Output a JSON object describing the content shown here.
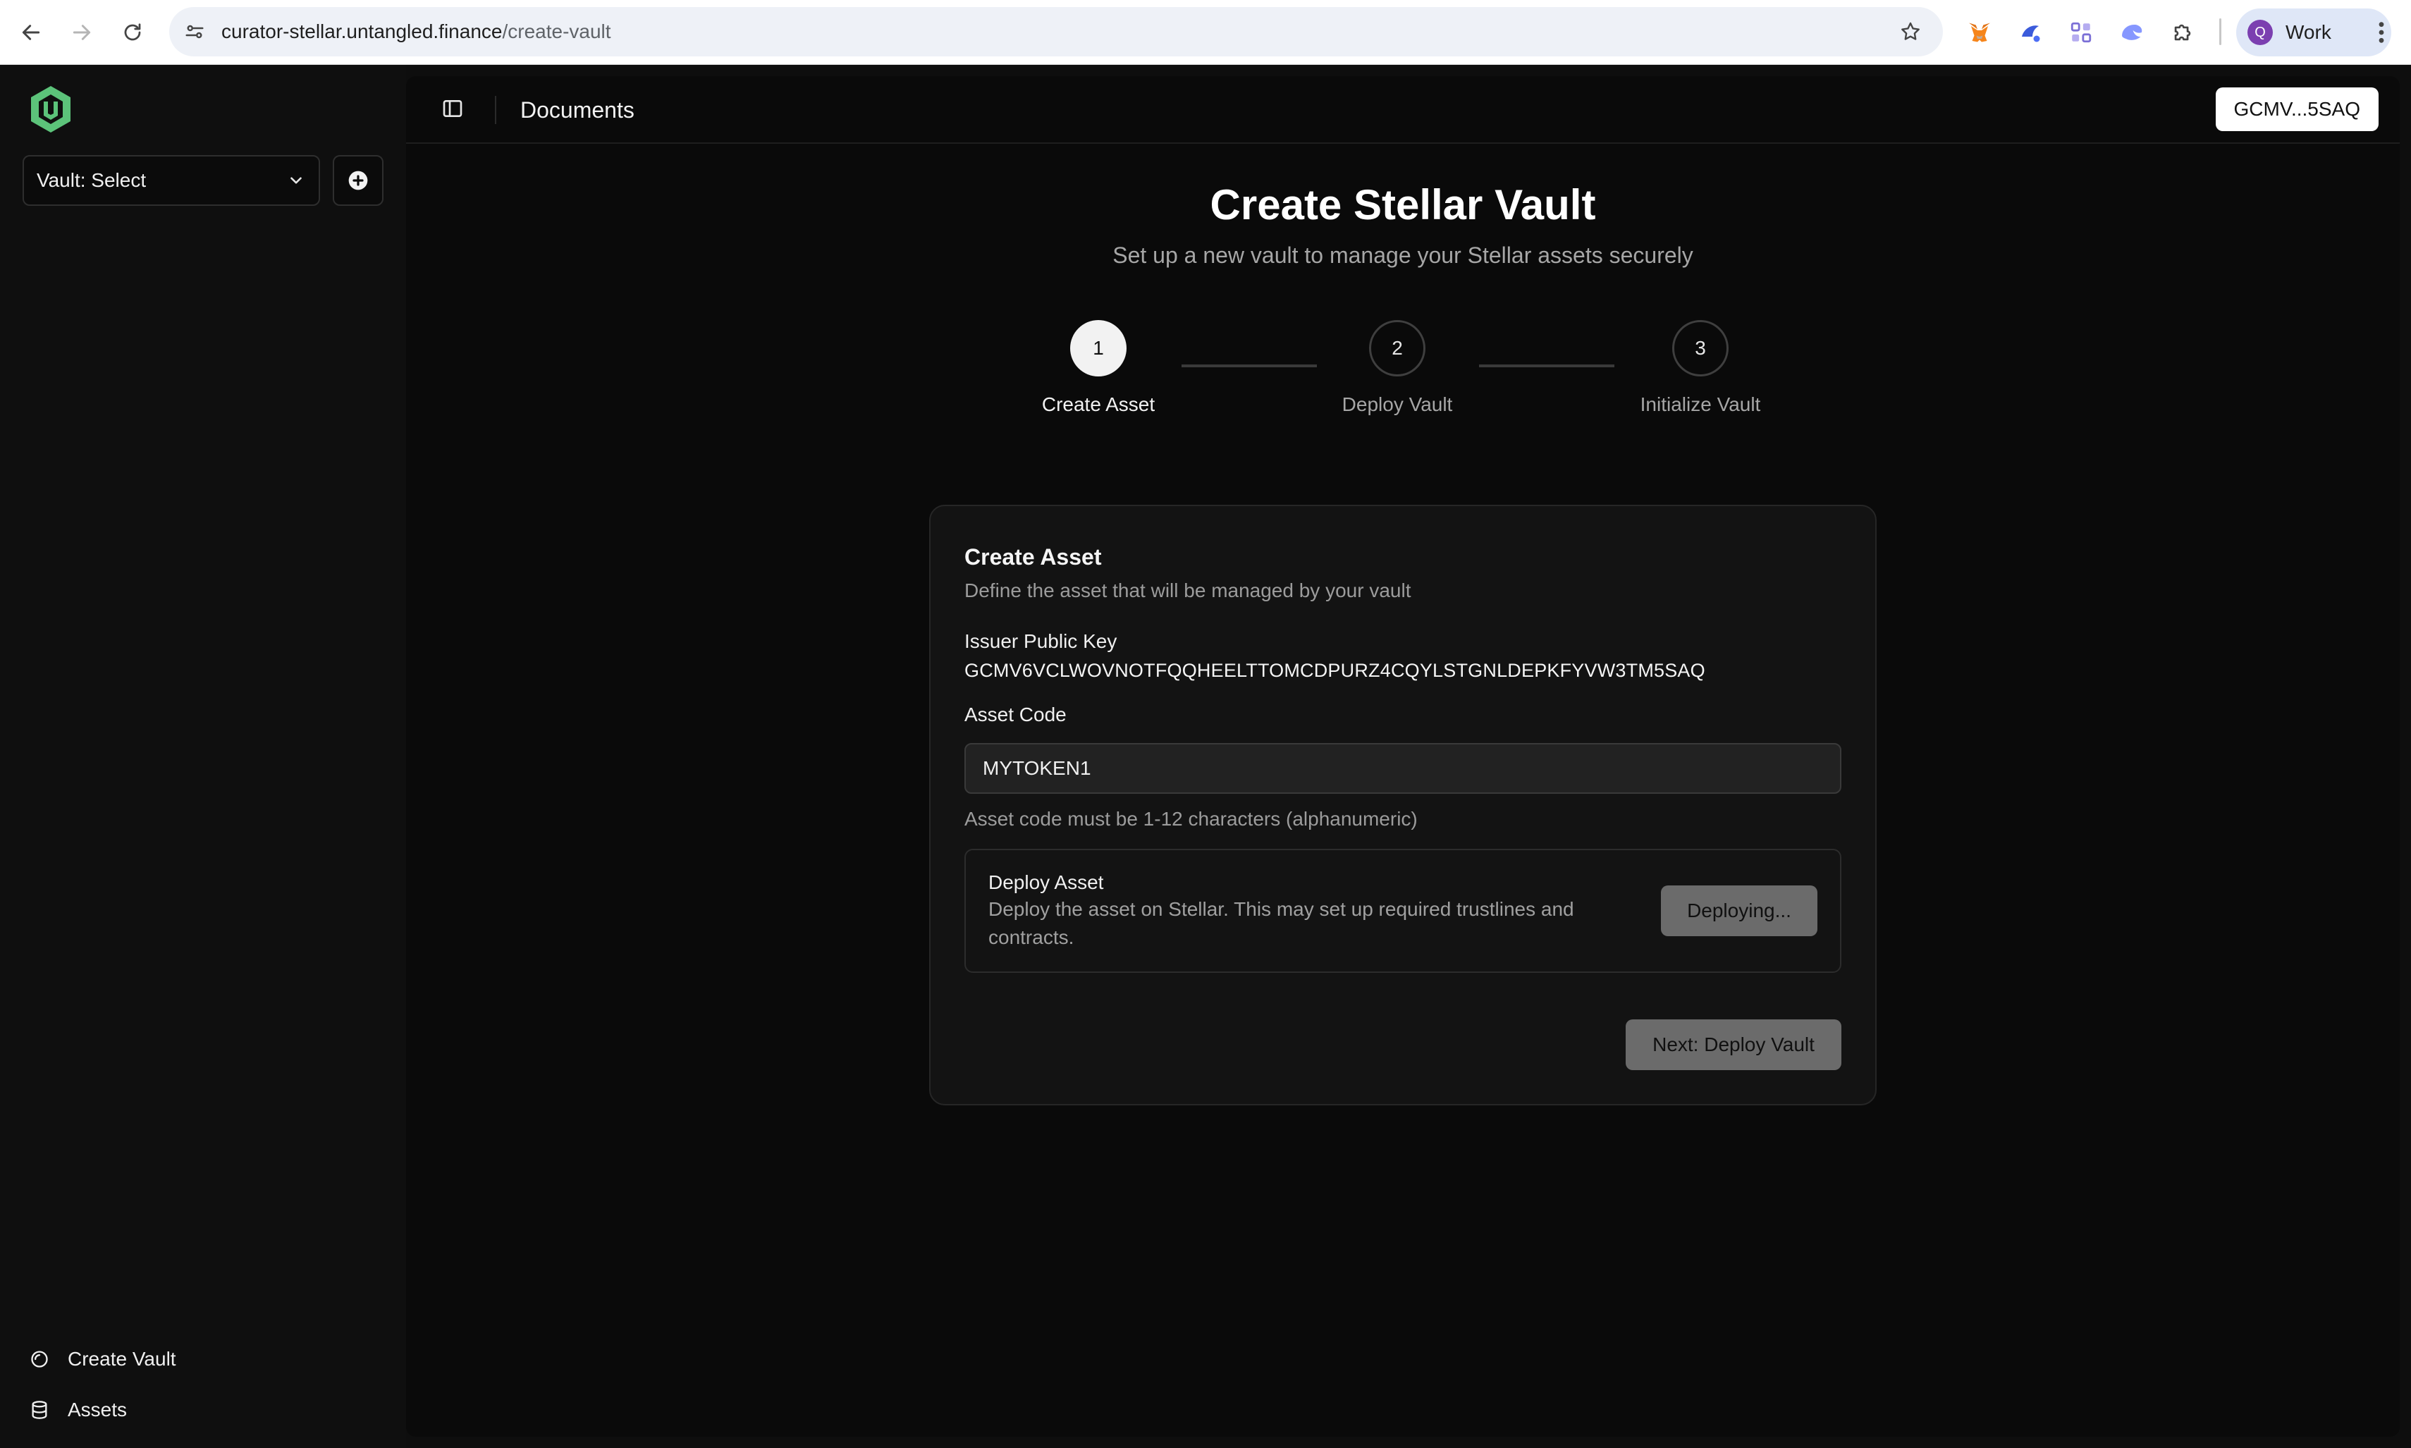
{
  "browser": {
    "url_host": "curator-stellar.untangled.finance",
    "url_path": "/create-vault",
    "profile_initial": "Q",
    "profile_name": "Work",
    "extensions": [
      "metamask-fox-icon",
      "freighter-icon",
      "extension-icon",
      "rabby-icon",
      "puzzle-icon"
    ]
  },
  "sidebar": {
    "vault_select_label": "Vault: Select",
    "nav": [
      {
        "label": "Create Vault",
        "icon": "circle-icon"
      },
      {
        "label": "Assets",
        "icon": "database-icon"
      }
    ]
  },
  "topbar": {
    "title": "Documents",
    "wallet_label": "GCMV...5SAQ"
  },
  "page": {
    "title": "Create Stellar Vault",
    "subtitle": "Set up a new vault to manage your Stellar assets securely"
  },
  "steps": [
    {
      "number": "1",
      "label": "Create Asset",
      "active": true
    },
    {
      "number": "2",
      "label": "Deploy Vault",
      "active": false
    },
    {
      "number": "3",
      "label": "Initialize Vault",
      "active": false
    }
  ],
  "card": {
    "title": "Create Asset",
    "subtitle": "Define the asset that will be managed by your vault",
    "issuer_label": "Issuer Public Key",
    "issuer_key": "GCMV6VCLWOVNOTFQQHEELTTOMCDPURZ4CQYLSTGNLDEPKFYVW3TM5SAQ",
    "asset_code_label": "Asset Code",
    "asset_code_value": "MYTOKEN1",
    "asset_code_hint": "Asset code must be 1-12 characters (alphanumeric)",
    "deploy": {
      "title": "Deploy Asset",
      "description": "Deploy the asset on Stellar. This may set up required trustlines and contracts.",
      "button_label": "Deploying..."
    },
    "next_label": "Next: Deploy Vault"
  },
  "colors": {
    "accent_green": "#5cc37a",
    "background": "#0a0a0a",
    "disabled_button": "#6b6b6b"
  }
}
